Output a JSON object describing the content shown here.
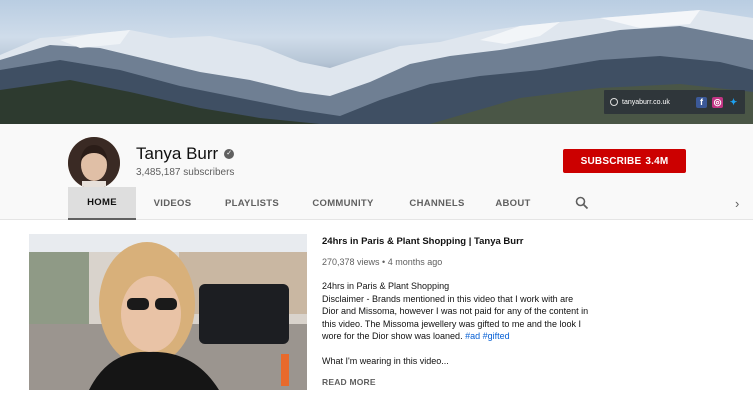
{
  "banner": {
    "website": "tanyaburr.co.uk",
    "social": [
      "facebook-icon",
      "instagram-icon",
      "twitter-icon"
    ]
  },
  "channel": {
    "name": "Tanya Burr",
    "subscribers": "3,485,187 subscribers",
    "subscribe_label": "SUBSCRIBE",
    "subscribe_count": "3.4M"
  },
  "tabs": [
    "HOME",
    "VIDEOS",
    "PLAYLISTS",
    "COMMUNITY",
    "CHANNELS",
    "ABOUT"
  ],
  "featured": {
    "title": "24hrs in Paris & Plant Shopping | Tanya Burr",
    "views": "270,378 views",
    "age": "4 months ago",
    "description_title": "24hrs in Paris & Plant Shopping",
    "description": "Disclaimer - Brands mentioned in this video that I work with are Dior and Missoma, however I was not paid for any of the content in this video. The Missoma jewellery was gifted to me and the look I wore for the Dior show was loaned.",
    "hashtags": [
      "#ad",
      "#gifted"
    ],
    "more_text": "What I'm wearing in this video...",
    "read_more": "READ MORE"
  },
  "colors": {
    "subscribe": "#cc0000",
    "link": "#065fd4"
  }
}
